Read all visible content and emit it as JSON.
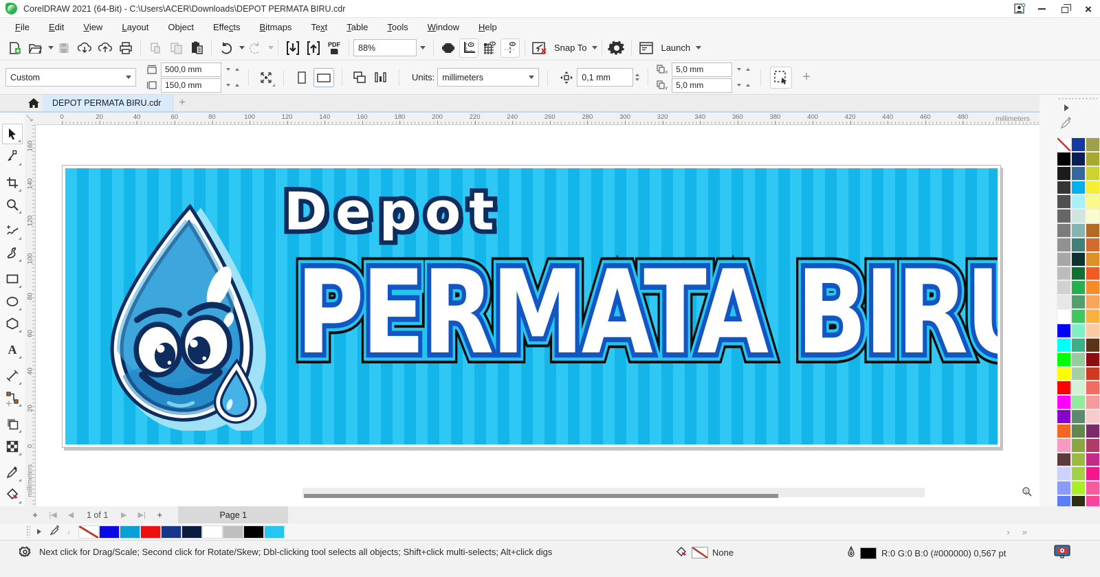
{
  "window": {
    "title": "CorelDRAW 2021 (64-Bit) - C:\\Users\\ACER\\Downloads\\DEPOT PERMATA BIRU.cdr"
  },
  "menu": {
    "items": [
      {
        "label": "File",
        "u": 0
      },
      {
        "label": "Edit",
        "u": 0
      },
      {
        "label": "View",
        "u": 0
      },
      {
        "label": "Layout",
        "u": 0
      },
      {
        "label": "Object",
        "u": 2
      },
      {
        "label": "Effects",
        "u": 4
      },
      {
        "label": "Bitmaps",
        "u": 0
      },
      {
        "label": "Text",
        "u": 2
      },
      {
        "label": "Table",
        "u": 0
      },
      {
        "label": "Tools",
        "u": 0
      },
      {
        "label": "Window",
        "u": 0
      },
      {
        "label": "Help",
        "u": 0
      }
    ]
  },
  "toolbar": {
    "zoom_level": "88%",
    "pdf_label": "PDF",
    "snap_to_label": "Snap To",
    "launch_label": "Launch"
  },
  "property_bar": {
    "preset": "Custom",
    "page_width": "500,0 mm",
    "page_height": "150,0 mm",
    "units_label": "Units:",
    "units": "millimeters",
    "nudge": "0,1 mm",
    "dup_x": "5,0 mm",
    "dup_y": "5,0 mm"
  },
  "doc_tab": {
    "title": "DEPOT PERMATA BIRU.cdr"
  },
  "ruler": {
    "h_labels": [
      0,
      20,
      40,
      60,
      80,
      100,
      120,
      140,
      160,
      180,
      200,
      220,
      240,
      260,
      280,
      300,
      320,
      340,
      360,
      380,
      400,
      420,
      440,
      460,
      480
    ],
    "v_labels": [
      160,
      140,
      120,
      100,
      80,
      60,
      40,
      20,
      0
    ],
    "unit": "millimeters"
  },
  "toolbox_tools": [
    "pick",
    "shape",
    "crop",
    "zoom",
    "freehand",
    "artistic-media",
    "rectangle",
    "ellipse",
    "polygon",
    "text",
    "dimension",
    "connector",
    "drop-shadow",
    "transparency",
    "color-eyedropper",
    "interactive-fill"
  ],
  "banner": {
    "line1": "Depot",
    "line2": "PERMATA BIRU",
    "stripe_light": "#2fc7f3",
    "stripe_dark": "#14b6ea",
    "outline_navy": "#0e2d5e",
    "outline_blue": "#1256c4",
    "outline_black": "#0d0d0d"
  },
  "pages": {
    "add": "+",
    "position": "1 of 1",
    "tab_label": "Page 1"
  },
  "document_palette": [
    "none",
    "#0a0ae6",
    "#0aa0d6",
    "#ee0f0f",
    "#16368c",
    "#0c1c3e",
    "#ffffff",
    "#bfbfbf",
    "#000000",
    "#29c5f1"
  ],
  "color_palette": {
    "rows": [
      [
        "none",
        "#1239a5",
        "#9fa04b"
      ],
      [
        "#000000",
        "#0a1f5a",
        "#a6a832"
      ],
      [
        "#1b1b1b",
        "#33699e",
        "#ccd22f"
      ],
      [
        "#363636",
        "#00b0f0",
        "#f4ef35"
      ],
      [
        "#505050",
        "#a5f2fc",
        "#f9f98e"
      ],
      [
        "#666666",
        "#cfe6e0",
        "#fbfbd0"
      ],
      [
        "#7c7c7c",
        "#85b5b0",
        "#b26a24"
      ],
      [
        "#919191",
        "#42807a",
        "#d16b2e"
      ],
      [
        "#a7a7a7",
        "#0d3431",
        "#dc9025"
      ],
      [
        "#bcbcbc",
        "#107030",
        "#f15a24"
      ],
      [
        "#d1d1d1",
        "#22b14c",
        "#f68b28"
      ],
      [
        "#e7e7e7",
        "#52a06d",
        "#f8a55f"
      ],
      [
        "#ffffff",
        "#3dc85f",
        "#fbb040"
      ],
      [
        "#0000ff",
        "#7df0c6",
        "#f8cba0"
      ],
      [
        "#00ffff",
        "#38b088",
        "#5c3317"
      ],
      [
        "#00ff00",
        "#97cba0",
        "#8c0e0e"
      ],
      [
        "#ffff00",
        "#a6cfa6",
        "#ce3a1c"
      ],
      [
        "#ff0000",
        "#d2f2d6",
        "#f26c62"
      ],
      [
        "#ff00ff",
        "#93ea9e",
        "#f79a9e"
      ],
      [
        "#8800cc",
        "#5c8a6e",
        "#f8caca"
      ],
      [
        "#f26522",
        "#62894a",
        "#7c2a68"
      ],
      [
        "#f79ac3",
        "#8aa63e",
        "#b03a68"
      ],
      [
        "#5c3a3c",
        "#9cba42",
        "#c22a8c"
      ],
      [
        "#ccd2fa",
        "#a2d244",
        "#f2188c"
      ],
      [
        "#8a9cf8",
        "#a9f022",
        "#f85a9e"
      ],
      [
        "#5c7cf8",
        "#2e2e10",
        "#f8449a"
      ],
      [
        "#6a70d6",
        "#6a6a38",
        "#d25a9a"
      ]
    ]
  },
  "status": {
    "hint": "Next click for Drag/Scale; Second click for Rotate/Skew; Dbl-clicking tool selects all objects; Shift+click multi-selects; Alt+click digs",
    "fill_label": "None",
    "outline_value": "R:0 G:0 B:0 (#000000)  0,567 pt"
  }
}
